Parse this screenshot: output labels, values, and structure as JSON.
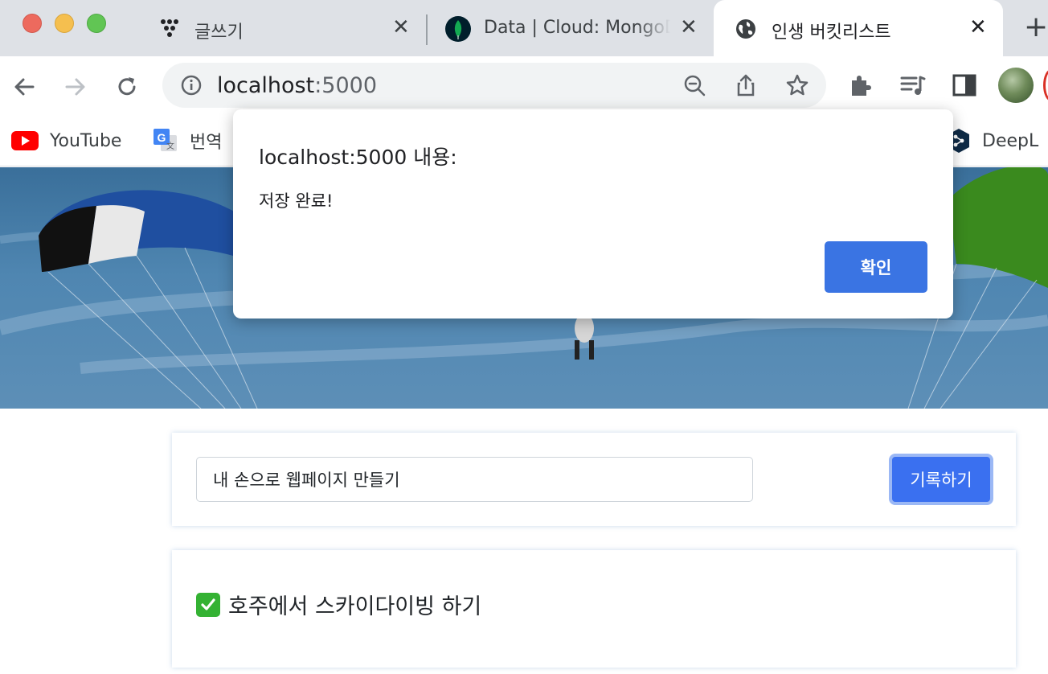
{
  "browser": {
    "tabs": [
      {
        "title": "글쓰기",
        "icon": "dots-logo-icon"
      },
      {
        "title": "Data | Cloud: MongoDB Cloud",
        "icon": "mongodb-leaf-icon"
      },
      {
        "title": "인생 버킷리스트",
        "icon": "globe-icon",
        "active": true
      }
    ],
    "address": {
      "host": "localhost",
      "port": ":5000"
    },
    "bookmarks": [
      {
        "label": "YouTube",
        "icon": "youtube-icon"
      },
      {
        "label": "번역",
        "icon": "google-translate-icon"
      },
      {
        "label": "DeepL",
        "icon": "deepl-icon"
      }
    ]
  },
  "dialog": {
    "title": "localhost:5000 내용:",
    "message": "저장 완료!",
    "ok_label": "확인"
  },
  "page": {
    "input_value": "내 손으로 웹페이지 만들기",
    "save_label": "기록하기",
    "bucket_items": [
      {
        "text": "호주에서 스카이다이빙 하기",
        "done": true
      }
    ]
  },
  "colors": {
    "accent": "#3a70f0",
    "dialog_button": "#3a74e3",
    "done_check": "#34b233"
  }
}
